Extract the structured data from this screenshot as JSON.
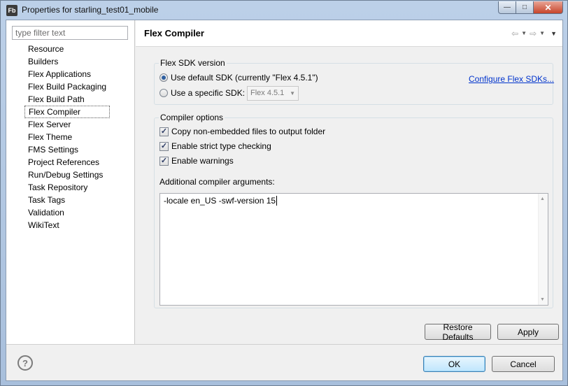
{
  "window": {
    "title": "Properties for starling_test01_mobile",
    "app_icon_text": "Fb"
  },
  "filter": {
    "placeholder": "type filter text",
    "value": ""
  },
  "nav": {
    "items": [
      "Resource",
      "Builders",
      "Flex Applications",
      "Flex Build Packaging",
      "Flex Build Path",
      "Flex Compiler",
      "Flex Server",
      "Flex Theme",
      "FMS Settings",
      "Project References",
      "Run/Debug Settings",
      "Task Repository",
      "Task Tags",
      "Validation",
      "WikiText"
    ],
    "selected": "Flex Compiler"
  },
  "page": {
    "title": "Flex Compiler"
  },
  "sdk": {
    "group_label": "Flex SDK version",
    "default_label": "Use default SDK (currently \"Flex 4.5.1\")",
    "specific_label": "Use a specific SDK:",
    "specific_value": "Flex 4.5.1",
    "configure_link": "Configure Flex SDKs...",
    "selected": "default"
  },
  "compiler": {
    "group_label": "Compiler options",
    "options": [
      {
        "label": "Copy non-embedded files to output folder",
        "checked": true
      },
      {
        "label": "Enable strict type checking",
        "checked": true
      },
      {
        "label": "Enable warnings",
        "checked": true
      }
    ],
    "args_label": "Additional compiler arguments:",
    "args_value": "-locale en_US -swf-version 15"
  },
  "buttons": {
    "restore_defaults": "Restore Defaults",
    "apply": "Apply",
    "ok": "OK",
    "cancel": "Cancel"
  },
  "icons": {
    "help": "?",
    "back": "⇦",
    "forward": "⇨",
    "dropdown": "▼",
    "view_menu": "▼",
    "check": "✓",
    "close": "✕",
    "minimize": "—",
    "maximize": "□"
  }
}
